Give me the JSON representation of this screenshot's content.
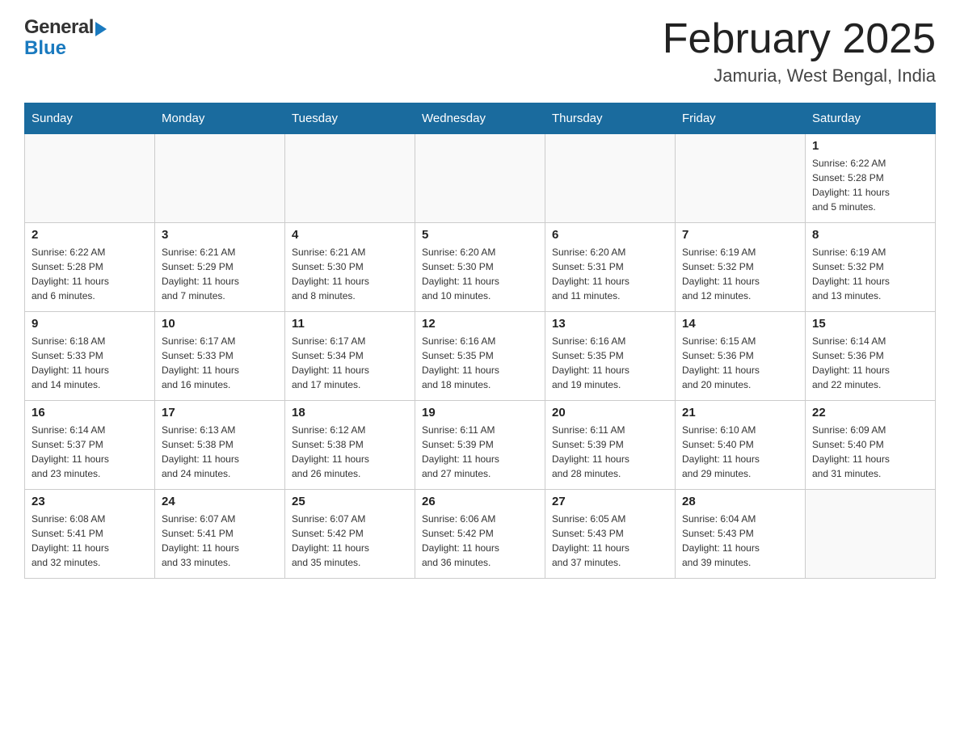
{
  "header": {
    "title": "February 2025",
    "subtitle": "Jamuria, West Bengal, India",
    "logo_general": "General",
    "logo_blue": "Blue"
  },
  "weekdays": [
    "Sunday",
    "Monday",
    "Tuesday",
    "Wednesday",
    "Thursday",
    "Friday",
    "Saturday"
  ],
  "weeks": [
    [
      {
        "day": "",
        "info": ""
      },
      {
        "day": "",
        "info": ""
      },
      {
        "day": "",
        "info": ""
      },
      {
        "day": "",
        "info": ""
      },
      {
        "day": "",
        "info": ""
      },
      {
        "day": "",
        "info": ""
      },
      {
        "day": "1",
        "info": "Sunrise: 6:22 AM\nSunset: 5:28 PM\nDaylight: 11 hours\nand 5 minutes."
      }
    ],
    [
      {
        "day": "2",
        "info": "Sunrise: 6:22 AM\nSunset: 5:28 PM\nDaylight: 11 hours\nand 6 minutes."
      },
      {
        "day": "3",
        "info": "Sunrise: 6:21 AM\nSunset: 5:29 PM\nDaylight: 11 hours\nand 7 minutes."
      },
      {
        "day": "4",
        "info": "Sunrise: 6:21 AM\nSunset: 5:30 PM\nDaylight: 11 hours\nand 8 minutes."
      },
      {
        "day": "5",
        "info": "Sunrise: 6:20 AM\nSunset: 5:30 PM\nDaylight: 11 hours\nand 10 minutes."
      },
      {
        "day": "6",
        "info": "Sunrise: 6:20 AM\nSunset: 5:31 PM\nDaylight: 11 hours\nand 11 minutes."
      },
      {
        "day": "7",
        "info": "Sunrise: 6:19 AM\nSunset: 5:32 PM\nDaylight: 11 hours\nand 12 minutes."
      },
      {
        "day": "8",
        "info": "Sunrise: 6:19 AM\nSunset: 5:32 PM\nDaylight: 11 hours\nand 13 minutes."
      }
    ],
    [
      {
        "day": "9",
        "info": "Sunrise: 6:18 AM\nSunset: 5:33 PM\nDaylight: 11 hours\nand 14 minutes."
      },
      {
        "day": "10",
        "info": "Sunrise: 6:17 AM\nSunset: 5:33 PM\nDaylight: 11 hours\nand 16 minutes."
      },
      {
        "day": "11",
        "info": "Sunrise: 6:17 AM\nSunset: 5:34 PM\nDaylight: 11 hours\nand 17 minutes."
      },
      {
        "day": "12",
        "info": "Sunrise: 6:16 AM\nSunset: 5:35 PM\nDaylight: 11 hours\nand 18 minutes."
      },
      {
        "day": "13",
        "info": "Sunrise: 6:16 AM\nSunset: 5:35 PM\nDaylight: 11 hours\nand 19 minutes."
      },
      {
        "day": "14",
        "info": "Sunrise: 6:15 AM\nSunset: 5:36 PM\nDaylight: 11 hours\nand 20 minutes."
      },
      {
        "day": "15",
        "info": "Sunrise: 6:14 AM\nSunset: 5:36 PM\nDaylight: 11 hours\nand 22 minutes."
      }
    ],
    [
      {
        "day": "16",
        "info": "Sunrise: 6:14 AM\nSunset: 5:37 PM\nDaylight: 11 hours\nand 23 minutes."
      },
      {
        "day": "17",
        "info": "Sunrise: 6:13 AM\nSunset: 5:38 PM\nDaylight: 11 hours\nand 24 minutes."
      },
      {
        "day": "18",
        "info": "Sunrise: 6:12 AM\nSunset: 5:38 PM\nDaylight: 11 hours\nand 26 minutes."
      },
      {
        "day": "19",
        "info": "Sunrise: 6:11 AM\nSunset: 5:39 PM\nDaylight: 11 hours\nand 27 minutes."
      },
      {
        "day": "20",
        "info": "Sunrise: 6:11 AM\nSunset: 5:39 PM\nDaylight: 11 hours\nand 28 minutes."
      },
      {
        "day": "21",
        "info": "Sunrise: 6:10 AM\nSunset: 5:40 PM\nDaylight: 11 hours\nand 29 minutes."
      },
      {
        "day": "22",
        "info": "Sunrise: 6:09 AM\nSunset: 5:40 PM\nDaylight: 11 hours\nand 31 minutes."
      }
    ],
    [
      {
        "day": "23",
        "info": "Sunrise: 6:08 AM\nSunset: 5:41 PM\nDaylight: 11 hours\nand 32 minutes."
      },
      {
        "day": "24",
        "info": "Sunrise: 6:07 AM\nSunset: 5:41 PM\nDaylight: 11 hours\nand 33 minutes."
      },
      {
        "day": "25",
        "info": "Sunrise: 6:07 AM\nSunset: 5:42 PM\nDaylight: 11 hours\nand 35 minutes."
      },
      {
        "day": "26",
        "info": "Sunrise: 6:06 AM\nSunset: 5:42 PM\nDaylight: 11 hours\nand 36 minutes."
      },
      {
        "day": "27",
        "info": "Sunrise: 6:05 AM\nSunset: 5:43 PM\nDaylight: 11 hours\nand 37 minutes."
      },
      {
        "day": "28",
        "info": "Sunrise: 6:04 AM\nSunset: 5:43 PM\nDaylight: 11 hours\nand 39 minutes."
      },
      {
        "day": "",
        "info": ""
      }
    ]
  ]
}
